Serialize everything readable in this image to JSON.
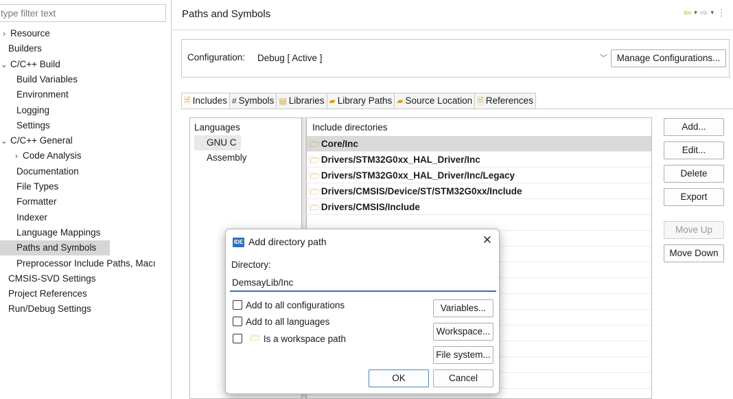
{
  "sidebar": {
    "filter_placeholder": "type filter text",
    "items": [
      {
        "label": "Resource",
        "indent": 0,
        "expander": "›"
      },
      {
        "label": "Builders",
        "indent": 1,
        "expander": ""
      },
      {
        "label": "C/C++ Build",
        "indent": 0,
        "expander": "⌄"
      },
      {
        "label": "Build Variables",
        "indent": 2,
        "expander": ""
      },
      {
        "label": "Environment",
        "indent": 2,
        "expander": ""
      },
      {
        "label": "Logging",
        "indent": 2,
        "expander": ""
      },
      {
        "label": "Settings",
        "indent": 2,
        "expander": ""
      },
      {
        "label": "C/C++ General",
        "indent": 0,
        "expander": "⌄"
      },
      {
        "label": "Code Analysis",
        "indent": 1.5,
        "expander": "›"
      },
      {
        "label": "Documentation",
        "indent": 2,
        "expander": ""
      },
      {
        "label": "File Types",
        "indent": 2,
        "expander": ""
      },
      {
        "label": "Formatter",
        "indent": 2,
        "expander": ""
      },
      {
        "label": "Indexer",
        "indent": 2,
        "expander": ""
      },
      {
        "label": "Language Mappings",
        "indent": 2,
        "expander": ""
      },
      {
        "label": "Paths and Symbols",
        "indent": 2,
        "expander": "",
        "selected": true
      },
      {
        "label": "Preprocessor Include Paths, Macı",
        "indent": 2,
        "expander": ""
      },
      {
        "label": "CMSIS-SVD Settings",
        "indent": 1,
        "expander": ""
      },
      {
        "label": "Project References",
        "indent": 1,
        "expander": ""
      },
      {
        "label": "Run/Debug Settings",
        "indent": 1,
        "expander": ""
      }
    ]
  },
  "header": {
    "title": "Paths and Symbols",
    "nav": {
      "back": "⇦",
      "forward": "⇨",
      "dropdown": "▾",
      "menu": "⋮"
    }
  },
  "configuration": {
    "label": "Configuration:",
    "value": "Debug  [ Active ]",
    "manage_label": "Manage Configurations..."
  },
  "tabs": [
    {
      "label": "Includes",
      "icon": "includes-icon",
      "glyph": "🗎",
      "active": true
    },
    {
      "label": "Symbols",
      "icon": "hash-icon",
      "glyph": "#"
    },
    {
      "label": "Libraries",
      "icon": "libraries-icon",
      "glyph": "▤"
    },
    {
      "label": "Library Paths",
      "icon": "library-paths-icon",
      "glyph": "▰"
    },
    {
      "label": "Source Location",
      "icon": "source-location-icon",
      "glyph": "▰"
    },
    {
      "label": "References",
      "icon": "references-icon",
      "glyph": "🗎"
    }
  ],
  "languages": {
    "header": "Languages",
    "items": [
      {
        "label": "GNU C",
        "selected": true
      },
      {
        "label": "Assembly"
      }
    ]
  },
  "includes": {
    "header": "Include directories",
    "rows": [
      {
        "path": "Core/Inc",
        "selected": true
      },
      {
        "path": "Drivers/STM32G0xx_HAL_Driver/Inc"
      },
      {
        "path": "Drivers/STM32G0xx_HAL_Driver/Inc/Legacy"
      },
      {
        "path": "Drivers/CMSIS/Device/ST/STM32G0xx/Include"
      },
      {
        "path": "Drivers/CMSIS/Include"
      }
    ]
  },
  "buttons": {
    "add": "Add...",
    "edit": "Edit...",
    "delete": "Delete",
    "export": "Export",
    "move_up": "Move Up",
    "move_down": "Move Down"
  },
  "dialog": {
    "badge": "IDE",
    "title": "Add directory path",
    "close": "✕",
    "directory_label": "Directory:",
    "directory_value": "DemsayLib/Inc",
    "checkboxes": {
      "all_configs": "Add to all configurations",
      "all_languages": "Add to all languages",
      "workspace_path": "Is a workspace path"
    },
    "buttons": {
      "variables": "Variables...",
      "workspace": "Workspace...",
      "filesystem": "File system...",
      "ok": "OK",
      "cancel": "Cancel"
    }
  },
  "colors": {
    "accent": "#2f6fbf",
    "folder": "#d9a21e",
    "selection": "#d6d6d6"
  }
}
